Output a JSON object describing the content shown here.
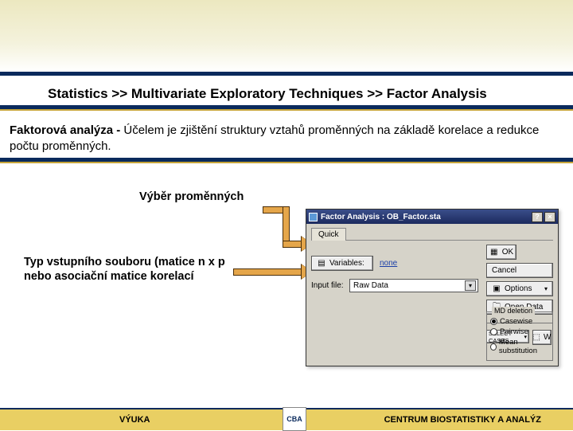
{
  "title": "Statistics >> Multivariate Exploratory Techniques >> Factor Analysis",
  "desc_bold": "Faktorová analýza -",
  "desc_rest": "  Účelem je zjištění struktury vztahů proměnných na základě korelace a redukce počtu proměnných.",
  "label_vars": "Výběr proměnných",
  "label_input_type": "Typ vstupního souboru (matice n x p nebo asociační matice korelací",
  "dialog": {
    "title": "Factor Analysis : OB_Factor.sta",
    "tab": "Quick",
    "variables_btn": "Variables:",
    "variables_value": "none",
    "input_label": "Input file:",
    "input_value": "Raw Data",
    "ok": "OK",
    "cancel": "Cancel",
    "options": "Options",
    "open": "Open Data",
    "select": "SELECT CASES",
    "w": "W",
    "md_group": "MD deletion",
    "radios": [
      "Casewise",
      "Pairwise",
      "Mean substitution"
    ],
    "selected_radio": 0
  },
  "footer": {
    "left": "VÝUKA",
    "logo": "CBA",
    "right": "CENTRUM BIOSTATISTIKY A ANALÝZ"
  }
}
